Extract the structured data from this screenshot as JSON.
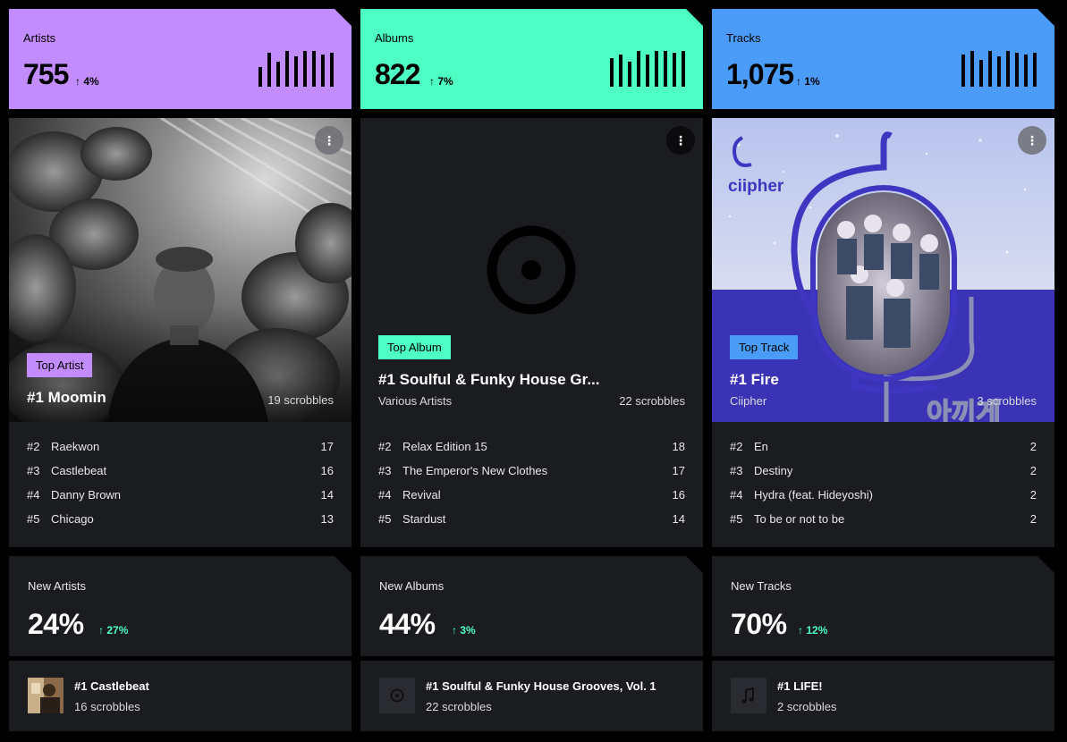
{
  "stats": [
    {
      "label": "Artists",
      "value": "755",
      "change": "4%",
      "arrow": "↑",
      "color": "#c38cfd",
      "bars": [
        0.55,
        0.95,
        0.7,
        1.0,
        0.85,
        1.0,
        1.0,
        0.9,
        0.95
      ]
    },
    {
      "label": "Albums",
      "value": "822",
      "change": "7%",
      "arrow": "↑",
      "color": "#4dffc4",
      "bars": [
        0.8,
        0.9,
        0.7,
        1.0,
        0.9,
        1.0,
        1.0,
        0.95,
        1.0
      ]
    },
    {
      "label": "Tracks",
      "value": "1,075",
      "change": "1%",
      "arrow": "↑",
      "color": "#4a9cf8",
      "bars": [
        0.9,
        1.0,
        0.75,
        1.0,
        0.85,
        1.0,
        0.95,
        0.9,
        0.95
      ]
    }
  ],
  "heroes": [
    {
      "badge": "Top Artist",
      "badge_color": "#c38cfd",
      "title": "#1 Moomin",
      "subtitle": "",
      "count": "19 scrobbles",
      "more_icon": "more-vertical-icon",
      "image": "artist-photo"
    },
    {
      "badge": "Top Album",
      "badge_color": "#4dffc4",
      "title": "#1 Soulful & Funky House Gr...",
      "subtitle": "Various Artists",
      "count": "22 scrobbles",
      "more_icon": "more-vertical-icon",
      "image": "vinyl-placeholder-icon"
    },
    {
      "badge": "Top Track",
      "badge_color": "#4a9cf8",
      "title": "#1 Fire",
      "subtitle": "Ciipher",
      "count": "3 scrobbles",
      "more_icon": "more-vertical-icon",
      "image": "album-cover",
      "cover_logo": "ciipher",
      "cover_text": "아끼게"
    }
  ],
  "lists": [
    [
      {
        "rank": "#2",
        "name": "Raekwon",
        "value": "17"
      },
      {
        "rank": "#3",
        "name": "Castlebeat",
        "value": "16"
      },
      {
        "rank": "#4",
        "name": "Danny Brown",
        "value": "14"
      },
      {
        "rank": "#5",
        "name": "Chicago",
        "value": "13"
      }
    ],
    [
      {
        "rank": "#2",
        "name": "Relax Edition 15",
        "value": "18"
      },
      {
        "rank": "#3",
        "name": "The Emperor's New Clothes",
        "value": "17"
      },
      {
        "rank": "#4",
        "name": "Revival",
        "value": "16"
      },
      {
        "rank": "#5",
        "name": "Stardust",
        "value": "14"
      }
    ],
    [
      {
        "rank": "#2",
        "name": "En",
        "value": "2"
      },
      {
        "rank": "#3",
        "name": "Destiny",
        "value": "2"
      },
      {
        "rank": "#4",
        "name": "Hydra (feat. Hideyoshi)",
        "value": "2"
      },
      {
        "rank": "#5",
        "name": "To be or not to be",
        "value": "2"
      }
    ]
  ],
  "new_stats": [
    {
      "label": "New Artists",
      "value": "24%",
      "change": "27%",
      "arrow": "↑"
    },
    {
      "label": "New Albums",
      "value": "44%",
      "change": "3%",
      "arrow": "↑"
    },
    {
      "label": "New Tracks",
      "value": "70%",
      "change": "12%",
      "arrow": "↑"
    }
  ],
  "top_new": [
    {
      "title": "#1 Castlebeat",
      "subtitle": "16 scrobbles",
      "icon": "artist-thumbnail"
    },
    {
      "title": "#1 Soulful & Funky House Grooves, Vol. 1",
      "subtitle": "22 scrobbles",
      "icon": "vinyl-icon"
    },
    {
      "title": "#1 LIFE!",
      "subtitle": "2 scrobbles",
      "icon": "music-note-icon"
    }
  ]
}
